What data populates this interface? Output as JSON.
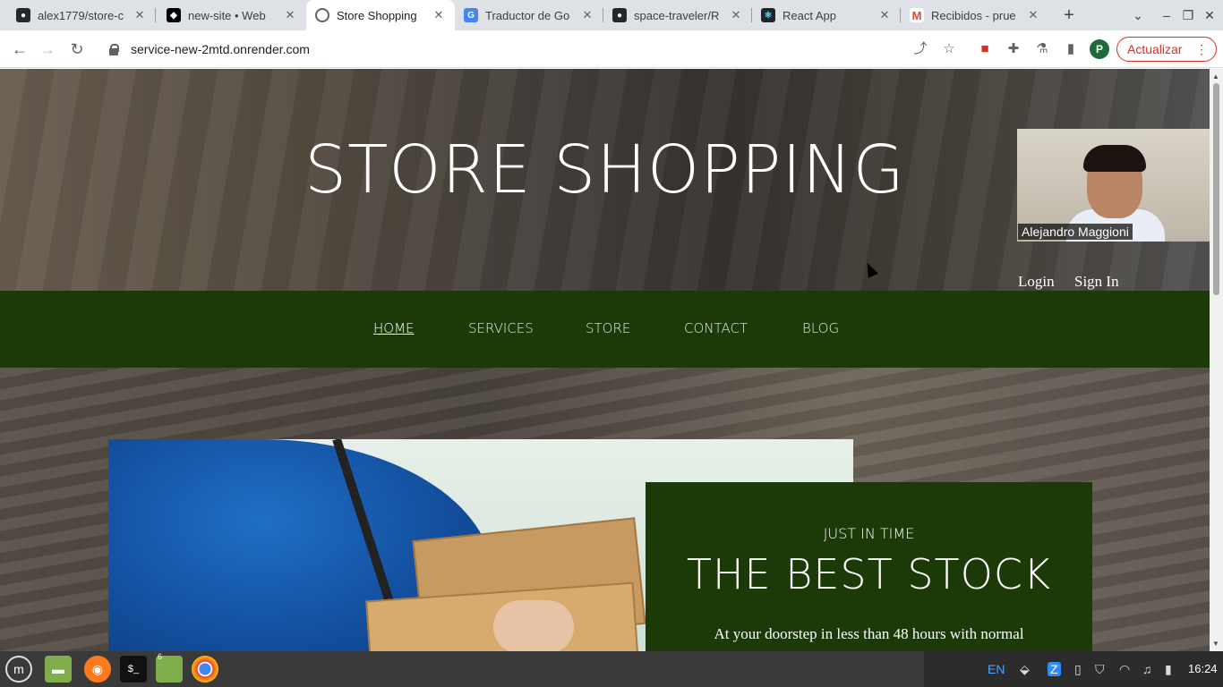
{
  "browser": {
    "tabs": [
      {
        "title": "alex1779/store-c",
        "icon": "github-icon",
        "active": false
      },
      {
        "title": "new-site • Web",
        "icon": "netlify-icon",
        "active": false
      },
      {
        "title": "Store Shopping",
        "icon": "globe-icon",
        "active": true
      },
      {
        "title": "Traductor de Go",
        "icon": "google-translate-icon",
        "active": false
      },
      {
        "title": "space-traveler/R",
        "icon": "github-icon",
        "active": false
      },
      {
        "title": "React App",
        "icon": "react-icon",
        "active": false
      },
      {
        "title": "Recibidos - prue",
        "icon": "gmail-icon",
        "active": false
      }
    ],
    "new_tab": "+",
    "url": "service-new-2mtd.onrender.com",
    "update_label": "Actualizar",
    "profile_initial": "P"
  },
  "page": {
    "hero_title": "STORE SHOPPING",
    "login_label": "Login",
    "signin_label": "Sign In",
    "nav": [
      {
        "label": "HOME",
        "current": true
      },
      {
        "label": "SERVICES",
        "current": false
      },
      {
        "label": "STORE",
        "current": false
      },
      {
        "label": "CONTACT",
        "current": false
      },
      {
        "label": "BLOG",
        "current": false
      }
    ],
    "feature": {
      "kicker": "JUST IN TIME",
      "title": "THE BEST STOCK",
      "text": "At your doorstep in less than 48 hours with normal"
    }
  },
  "video_call": {
    "participant": "Alejandro Maggioni"
  },
  "taskbar": {
    "terminal_label": "$_",
    "files_badge": "6",
    "language": "EN",
    "clock": "16:24"
  },
  "colors": {
    "brand_green": "#1c3a08",
    "update_red": "#d93025"
  }
}
